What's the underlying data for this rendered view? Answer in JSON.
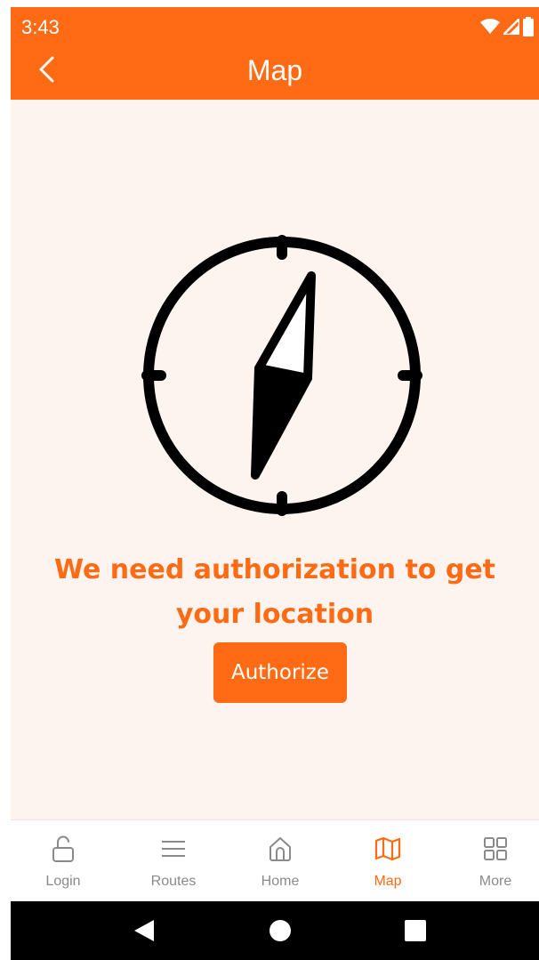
{
  "status_bar": {
    "time": "3:43",
    "icons": [
      "wifi-icon",
      "signal-icon",
      "battery-icon"
    ]
  },
  "toolbar": {
    "title": "Map",
    "back_icon": "chevron-left-icon"
  },
  "content": {
    "illustration_icon": "compass-icon",
    "message_line1": "We need authorization to get",
    "message_line2": "your location",
    "authorize_label": "Authorize"
  },
  "bottom_nav": {
    "items": [
      {
        "label": "Login",
        "icon": "unlock-icon",
        "active": false
      },
      {
        "label": "Routes",
        "icon": "menu-icon",
        "active": false
      },
      {
        "label": "Home",
        "icon": "home-icon",
        "active": false
      },
      {
        "label": "Map",
        "icon": "map-icon",
        "active": true
      },
      {
        "label": "More",
        "icon": "grid-icon",
        "active": false
      }
    ]
  },
  "system_nav": {
    "buttons": [
      "back-triangle-icon",
      "home-circle-icon",
      "recents-square-icon"
    ]
  },
  "colors": {
    "accent": "#ff6b14",
    "background": "#fdf4ef",
    "inactive": "#8a8a8a"
  }
}
